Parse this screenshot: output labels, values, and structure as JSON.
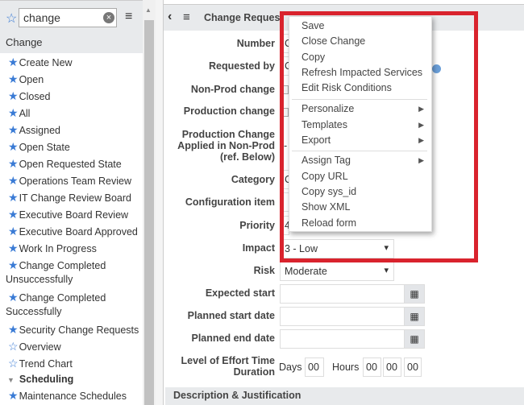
{
  "sidebar": {
    "search_value": "change",
    "section": "Change",
    "items": [
      {
        "label": "Create New",
        "fav": true
      },
      {
        "label": "Open",
        "fav": true
      },
      {
        "label": "Closed",
        "fav": true
      },
      {
        "label": "All",
        "fav": true
      },
      {
        "label": "Assigned",
        "fav": true
      },
      {
        "label": "Open State",
        "fav": true
      },
      {
        "label": "Open Requested State",
        "fav": true
      },
      {
        "label": "Operations Team Review",
        "fav": true
      },
      {
        "label": "IT Change Review Board",
        "fav": true
      },
      {
        "label": "Executive Board Review",
        "fav": true
      },
      {
        "label": "Executive Board Approved",
        "fav": true
      },
      {
        "label": "Work In Progress",
        "fav": true
      },
      {
        "label": "Change Completed",
        "label2": "Unsuccessfully",
        "fav": true
      },
      {
        "label": "Change Completed",
        "label2": "Successfully",
        "fav": true
      },
      {
        "label": "Security Change Requests",
        "fav": true
      },
      {
        "label": "Overview",
        "fav": false
      },
      {
        "label": "Trend Chart",
        "fav": false
      },
      {
        "label": "Scheduling",
        "group": true
      },
      {
        "label": "Maintenance Schedules",
        "fav": true
      }
    ]
  },
  "header": {
    "title": "Change Request"
  },
  "form": {
    "number": "Number",
    "number_value": "C",
    "requested_by": "Requested by",
    "requested_by_value": "C",
    "non_prod": "Non-Prod change",
    "production": "Production change",
    "pca1": "Production Change",
    "pca2": "Applied in Non-Prod",
    "pca3": "(ref. Below)",
    "pca_value": "-",
    "category": "Category",
    "category_value": "C",
    "config": "Configuration item",
    "priority": "Priority",
    "priority_value": "4",
    "impact": "Impact",
    "impact_value": "3 - Low",
    "risk": "Risk",
    "risk_value": "Moderate",
    "expected_start": "Expected start",
    "planned_start": "Planned start date",
    "planned_end": "Planned end date",
    "loe1": "Level of Effort Time",
    "loe2": "Duration",
    "days_label": "Days",
    "days_value": "00",
    "hours_label": "Hours",
    "hh": "00",
    "mm": "00",
    "ss": "00",
    "section_desc": "Description & Justification"
  },
  "menu": {
    "save": "Save",
    "close_change": "Close Change",
    "copy": "Copy",
    "refresh": "Refresh Impacted Services",
    "edit_risk": "Edit Risk Conditions",
    "personalize": "Personalize",
    "templates": "Templates",
    "export": "Export",
    "assign_tag": "Assign Tag",
    "copy_url": "Copy URL",
    "copy_sysid": "Copy sys_id",
    "show_xml": "Show XML",
    "reload": "Reload form"
  },
  "colors": {
    "highlight": "#d9232d",
    "star": "#3a7bd5"
  }
}
